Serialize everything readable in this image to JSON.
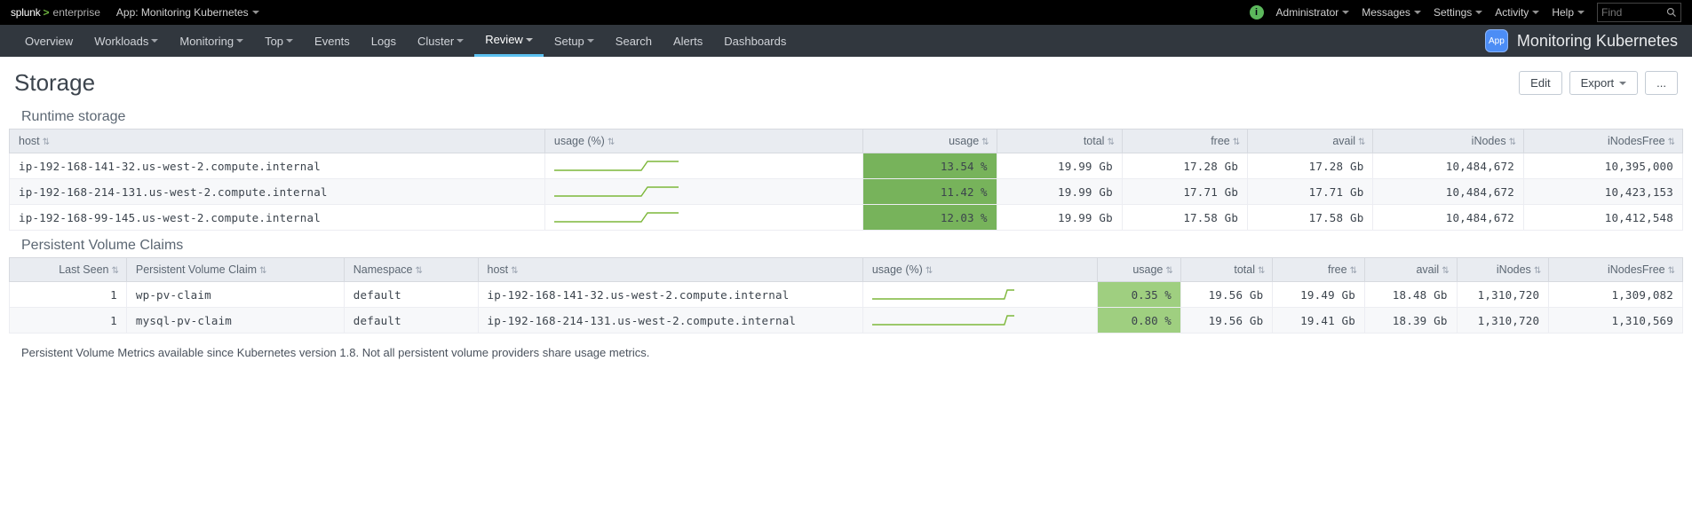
{
  "topbar": {
    "logo_splunk": "splunk",
    "logo_enterprise": "enterprise",
    "app_label": "App: Monitoring Kubernetes",
    "user": "Administrator",
    "menu_messages": "Messages",
    "menu_settings": "Settings",
    "menu_activity": "Activity",
    "menu_help": "Help",
    "find_placeholder": "Find"
  },
  "nav": {
    "items": [
      {
        "label": "Overview",
        "caret": false,
        "active": false
      },
      {
        "label": "Workloads",
        "caret": true,
        "active": false
      },
      {
        "label": "Monitoring",
        "caret": true,
        "active": false
      },
      {
        "label": "Top",
        "caret": true,
        "active": false
      },
      {
        "label": "Events",
        "caret": false,
        "active": false
      },
      {
        "label": "Logs",
        "caret": false,
        "active": false
      },
      {
        "label": "Cluster",
        "caret": true,
        "active": false
      },
      {
        "label": "Review",
        "caret": true,
        "active": true
      },
      {
        "label": "Setup",
        "caret": true,
        "active": false
      },
      {
        "label": "Search",
        "caret": false,
        "active": false
      },
      {
        "label": "Alerts",
        "caret": false,
        "active": false
      },
      {
        "label": "Dashboards",
        "caret": false,
        "active": false
      }
    ],
    "right_badge": "App",
    "right_label": "Monitoring Kubernetes"
  },
  "page": {
    "title": "Storage",
    "btn_edit": "Edit",
    "btn_export": "Export",
    "btn_more": "..."
  },
  "section_runtime": {
    "title": "Runtime storage",
    "columns": [
      "host",
      "usage (%)",
      "usage",
      "total",
      "free",
      "avail",
      "iNodes",
      "iNodesFree"
    ],
    "rows": [
      {
        "host": "ip-192-168-141-32.us-west-2.compute.internal",
        "usage_pct": "13.54 %",
        "total": "19.99 Gb",
        "free": "17.28 Gb",
        "avail": "17.28 Gb",
        "inodes": "10,484,672",
        "inodes_free": "10,395,000"
      },
      {
        "host": "ip-192-168-214-131.us-west-2.compute.internal",
        "usage_pct": "11.42 %",
        "total": "19.99 Gb",
        "free": "17.71 Gb",
        "avail": "17.71 Gb",
        "inodes": "10,484,672",
        "inodes_free": "10,423,153"
      },
      {
        "host": "ip-192-168-99-145.us-west-2.compute.internal",
        "usage_pct": "12.03 %",
        "total": "19.99 Gb",
        "free": "17.58 Gb",
        "avail": "17.58 Gb",
        "inodes": "10,484,672",
        "inodes_free": "10,412,548"
      }
    ]
  },
  "section_pvc": {
    "title": "Persistent Volume Claims",
    "columns": [
      "Last Seen",
      "Persistent Volume Claim",
      "Namespace",
      "host",
      "usage (%)",
      "usage",
      "total",
      "free",
      "avail",
      "iNodes",
      "iNodesFree"
    ],
    "rows": [
      {
        "last_seen": "1",
        "pvc": "wp-pv-claim",
        "namespace": "default",
        "host": "ip-192-168-141-32.us-west-2.compute.internal",
        "usage_pct": "0.35 %",
        "total": "19.56 Gb",
        "free": "19.49 Gb",
        "avail": "18.48 Gb",
        "inodes": "1,310,720",
        "inodes_free": "1,309,082"
      },
      {
        "last_seen": "1",
        "pvc": "mysql-pv-claim",
        "namespace": "default",
        "host": "ip-192-168-214-131.us-west-2.compute.internal",
        "usage_pct": "0.80 %",
        "total": "19.56 Gb",
        "free": "19.41 Gb",
        "avail": "18.39 Gb",
        "inodes": "1,310,720",
        "inodes_free": "1,310,569"
      }
    ]
  },
  "footer_note": "Persistent Volume Metrics available since Kubernetes version 1.8. Not all persistent volume providers share usage metrics."
}
